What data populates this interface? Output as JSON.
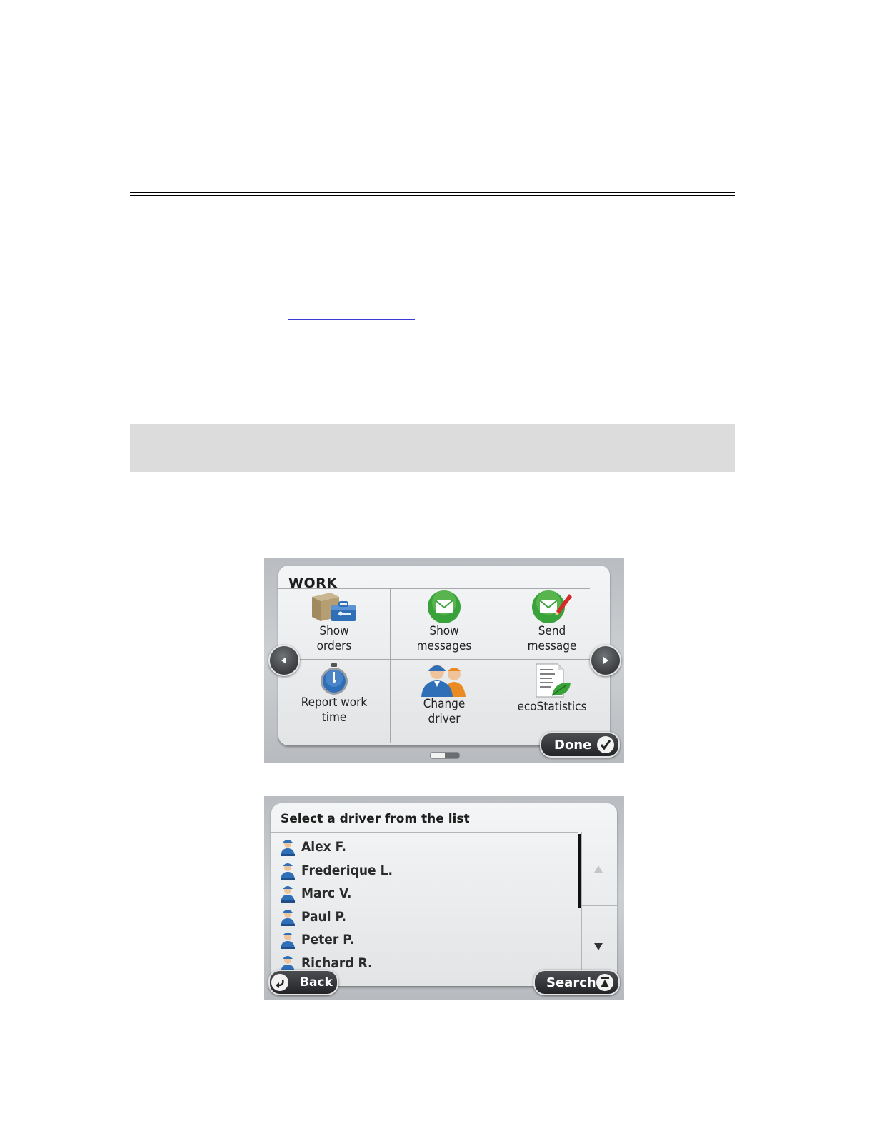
{
  "work_screen": {
    "title": "WORK",
    "tiles": [
      {
        "label": "Show\norders",
        "icon": "orders-box-icon"
      },
      {
        "label": "Show\nmessages",
        "icon": "envelope-icon"
      },
      {
        "label": "Send\nmessage",
        "icon": "send-message-icon"
      },
      {
        "label": "Report work\ntime",
        "icon": "stopwatch-icon"
      },
      {
        "label": "Change\ndriver",
        "icon": "drivers-icon"
      },
      {
        "label": "ecoStatistics",
        "icon": "eco-statistics-icon"
      }
    ],
    "done_label": "Done"
  },
  "driver_screen": {
    "title": "Select a driver from the list",
    "drivers": [
      "Alex F.",
      "Frederique L.",
      "Marc V.",
      "Paul P.",
      "Peter P.",
      "Richard R."
    ],
    "back_label": "Back",
    "search_label": "Search"
  },
  "colors": {
    "link": "#3a3ad8",
    "band": "#dcdcdc",
    "green_icon": "#3aa23a",
    "blue_icon": "#2f6fb8"
  }
}
